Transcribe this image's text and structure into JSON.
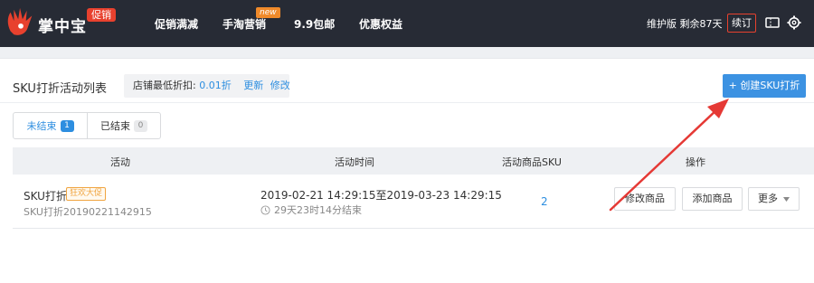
{
  "header": {
    "brand": "掌中宝",
    "brand_tag": "促销",
    "nav": [
      {
        "label": "促销满减"
      },
      {
        "label": "手淘营销",
        "badge": "new"
      },
      {
        "label": "9.9包邮"
      },
      {
        "label": "优惠权益"
      }
    ],
    "version_text": "维护版 剩余87天",
    "renew_label": "续订",
    "icons": [
      "ticket-icon",
      "gear-icon"
    ]
  },
  "page": {
    "title": "SKU打折活动列表",
    "min_discount_label": "店铺最低折扣:",
    "min_discount_value": "0.01折",
    "update_link": "更新",
    "edit_link": "修改",
    "create_button": "+ 创建SKU打折"
  },
  "tabs": [
    {
      "label": "未结束",
      "count": "1",
      "active": true
    },
    {
      "label": "已结束",
      "count": "0",
      "active": false
    }
  ],
  "table": {
    "columns": [
      "活动",
      "活动时间",
      "活动商品SKU",
      "操作"
    ],
    "rows": [
      {
        "name": "SKU打折",
        "tag": "狂欢大促",
        "id": "SKU打折20190221142915",
        "time_range": "2019-02-21 14:29:15至2019-03-23 14:29:15",
        "remaining": "29天23时14分结束",
        "sku_count": "2",
        "actions": [
          "修改商品",
          "添加商品",
          "更多"
        ]
      }
    ]
  },
  "colors": {
    "topbar_bg": "#272b35",
    "accent_blue": "#3c92e2",
    "promo_red": "#e8412e",
    "tag_orange": "#f0a541",
    "annotation_red": "#e53935"
  }
}
